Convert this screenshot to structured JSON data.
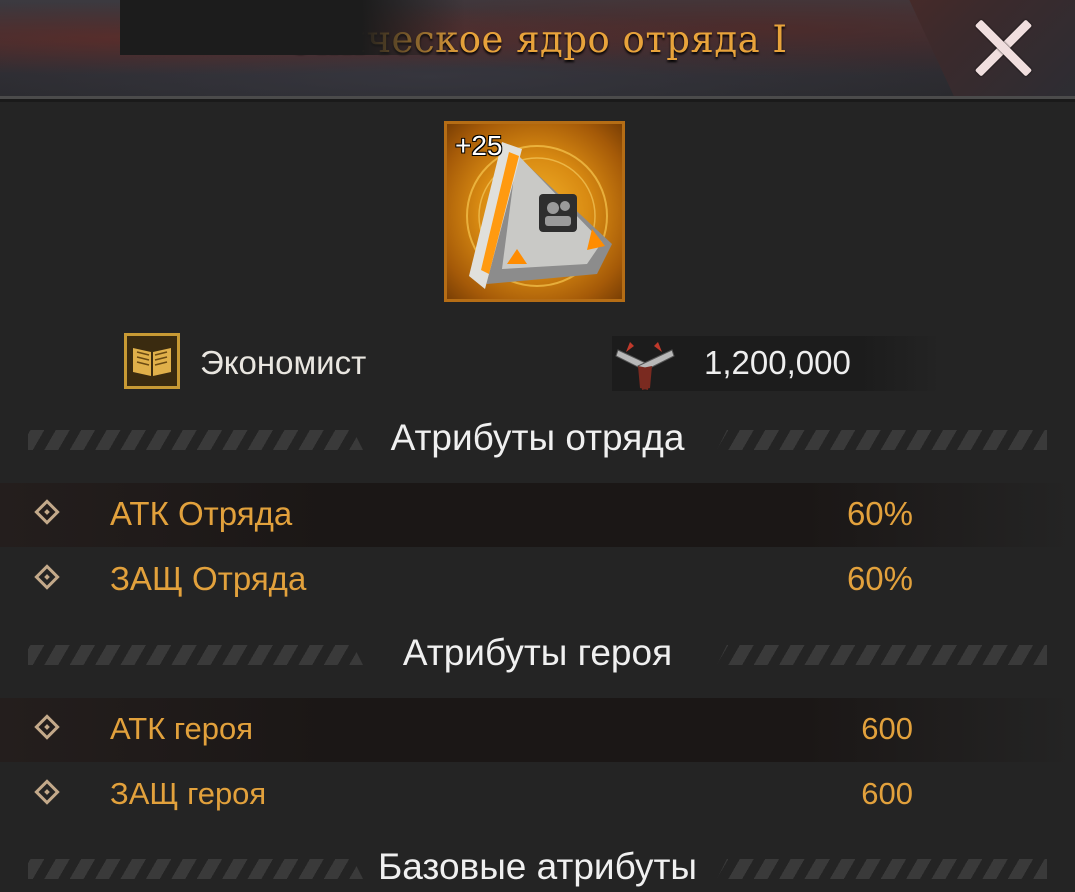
{
  "window": {
    "title": "Эпическое ядро отряда I"
  },
  "item": {
    "level_badge": "+25",
    "icon": "squad-core-icon",
    "frame_color": "#b56d15"
  },
  "info": {
    "class_icon": "book-icon",
    "class_label": "Экономист",
    "power_icon": "crossed-pistols-icon",
    "power_value": "1,200,000"
  },
  "sections": {
    "squad": {
      "title": "Атрибуты отряда",
      "rows": [
        {
          "label": "АТК Отряда",
          "value": "60%"
        },
        {
          "label": "ЗАЩ Отряда",
          "value": "60%"
        }
      ]
    },
    "hero": {
      "title": "Атрибуты героя",
      "rows": [
        {
          "label": "АТК героя",
          "value": "600"
        },
        {
          "label": "ЗАЩ героя",
          "value": "600"
        }
      ]
    },
    "base": {
      "title": "Базовые атрибуты"
    }
  },
  "colors": {
    "accent": "#e2a13c",
    "title": "#e8a33b",
    "background": "#242424"
  }
}
